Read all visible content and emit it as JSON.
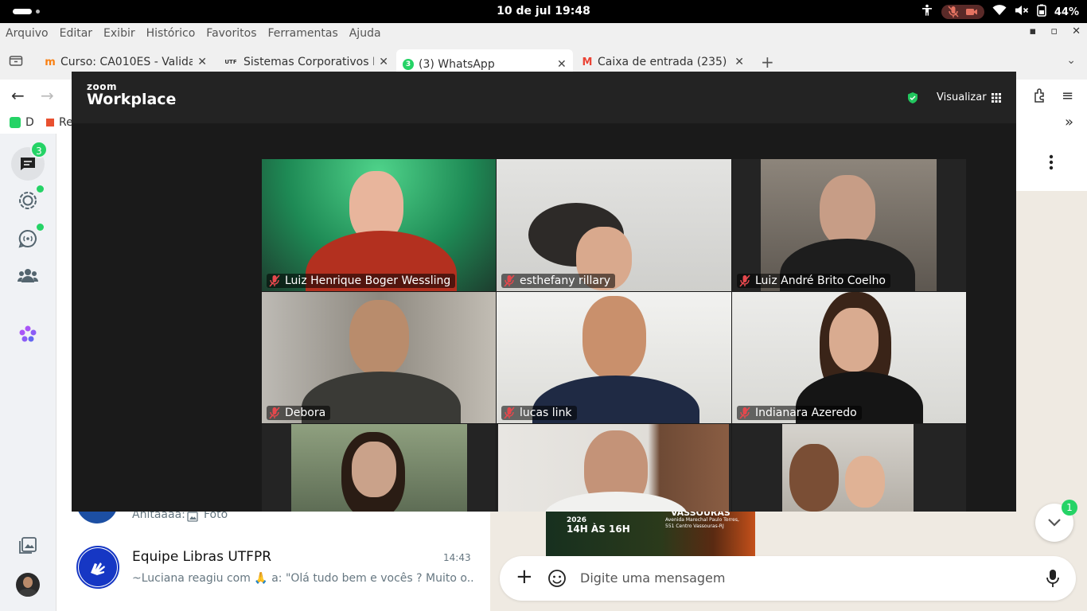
{
  "system": {
    "clock": "10 de jul  19:48",
    "battery": "44%"
  },
  "menubar": [
    "Arquivo",
    "Editar",
    "Exibir",
    "Histórico",
    "Favoritos",
    "Ferramentas",
    "Ajuda"
  ],
  "tabs": [
    {
      "title": "Curso: CA010ES - Validaç",
      "favicon": "m"
    },
    {
      "title": "Sistemas Corporativos In",
      "favicon": "UTFPR"
    },
    {
      "title": "(3) WhatsApp",
      "favicon": "3"
    },
    {
      "title": "Caixa de entrada (235) -",
      "favicon": "M"
    }
  ],
  "bookmarks": [
    "D",
    "Re"
  ],
  "whatsapp": {
    "unread_badge": "3",
    "scroll_badge": "1",
    "partial_preview": "Anitaaaa:",
    "partial_preview_media": "Foto",
    "chat": {
      "name": "Equipe Libras UTFPR",
      "time": "14:43",
      "preview": "~Luciana reagiu com 🙏 a: \"Olá tudo bem e vocês ? Muito o..."
    },
    "composer_placeholder": "Digite uma mensagem",
    "poster_line1": "2026",
    "poster_line2": "14H ÀS 16H",
    "poster_city": "VASSOURAS",
    "poster_addr1": "Avenida Marechal Paulo Torres,",
    "poster_addr2": "551 Centro Vassouras-RJ"
  },
  "zoom": {
    "brand_small": "zoom",
    "brand_large": "Workplace",
    "view_label": "Visualizar",
    "participants": [
      {
        "name": "Luiz Henrique Boger Wessling"
      },
      {
        "name": "esthefany rillary"
      },
      {
        "name": "Luiz André Brito Coelho"
      },
      {
        "name": "Debora"
      },
      {
        "name": "lucas link",
        "speaking": true
      },
      {
        "name": "Indianara Azeredo"
      },
      {
        "name": ""
      },
      {
        "name": ""
      },
      {
        "name": ""
      }
    ]
  },
  "colors": {
    "zoom_bg": "#1a1a1a",
    "speaking_border": "#3fbf5a",
    "wa_badge": "#25d366"
  }
}
